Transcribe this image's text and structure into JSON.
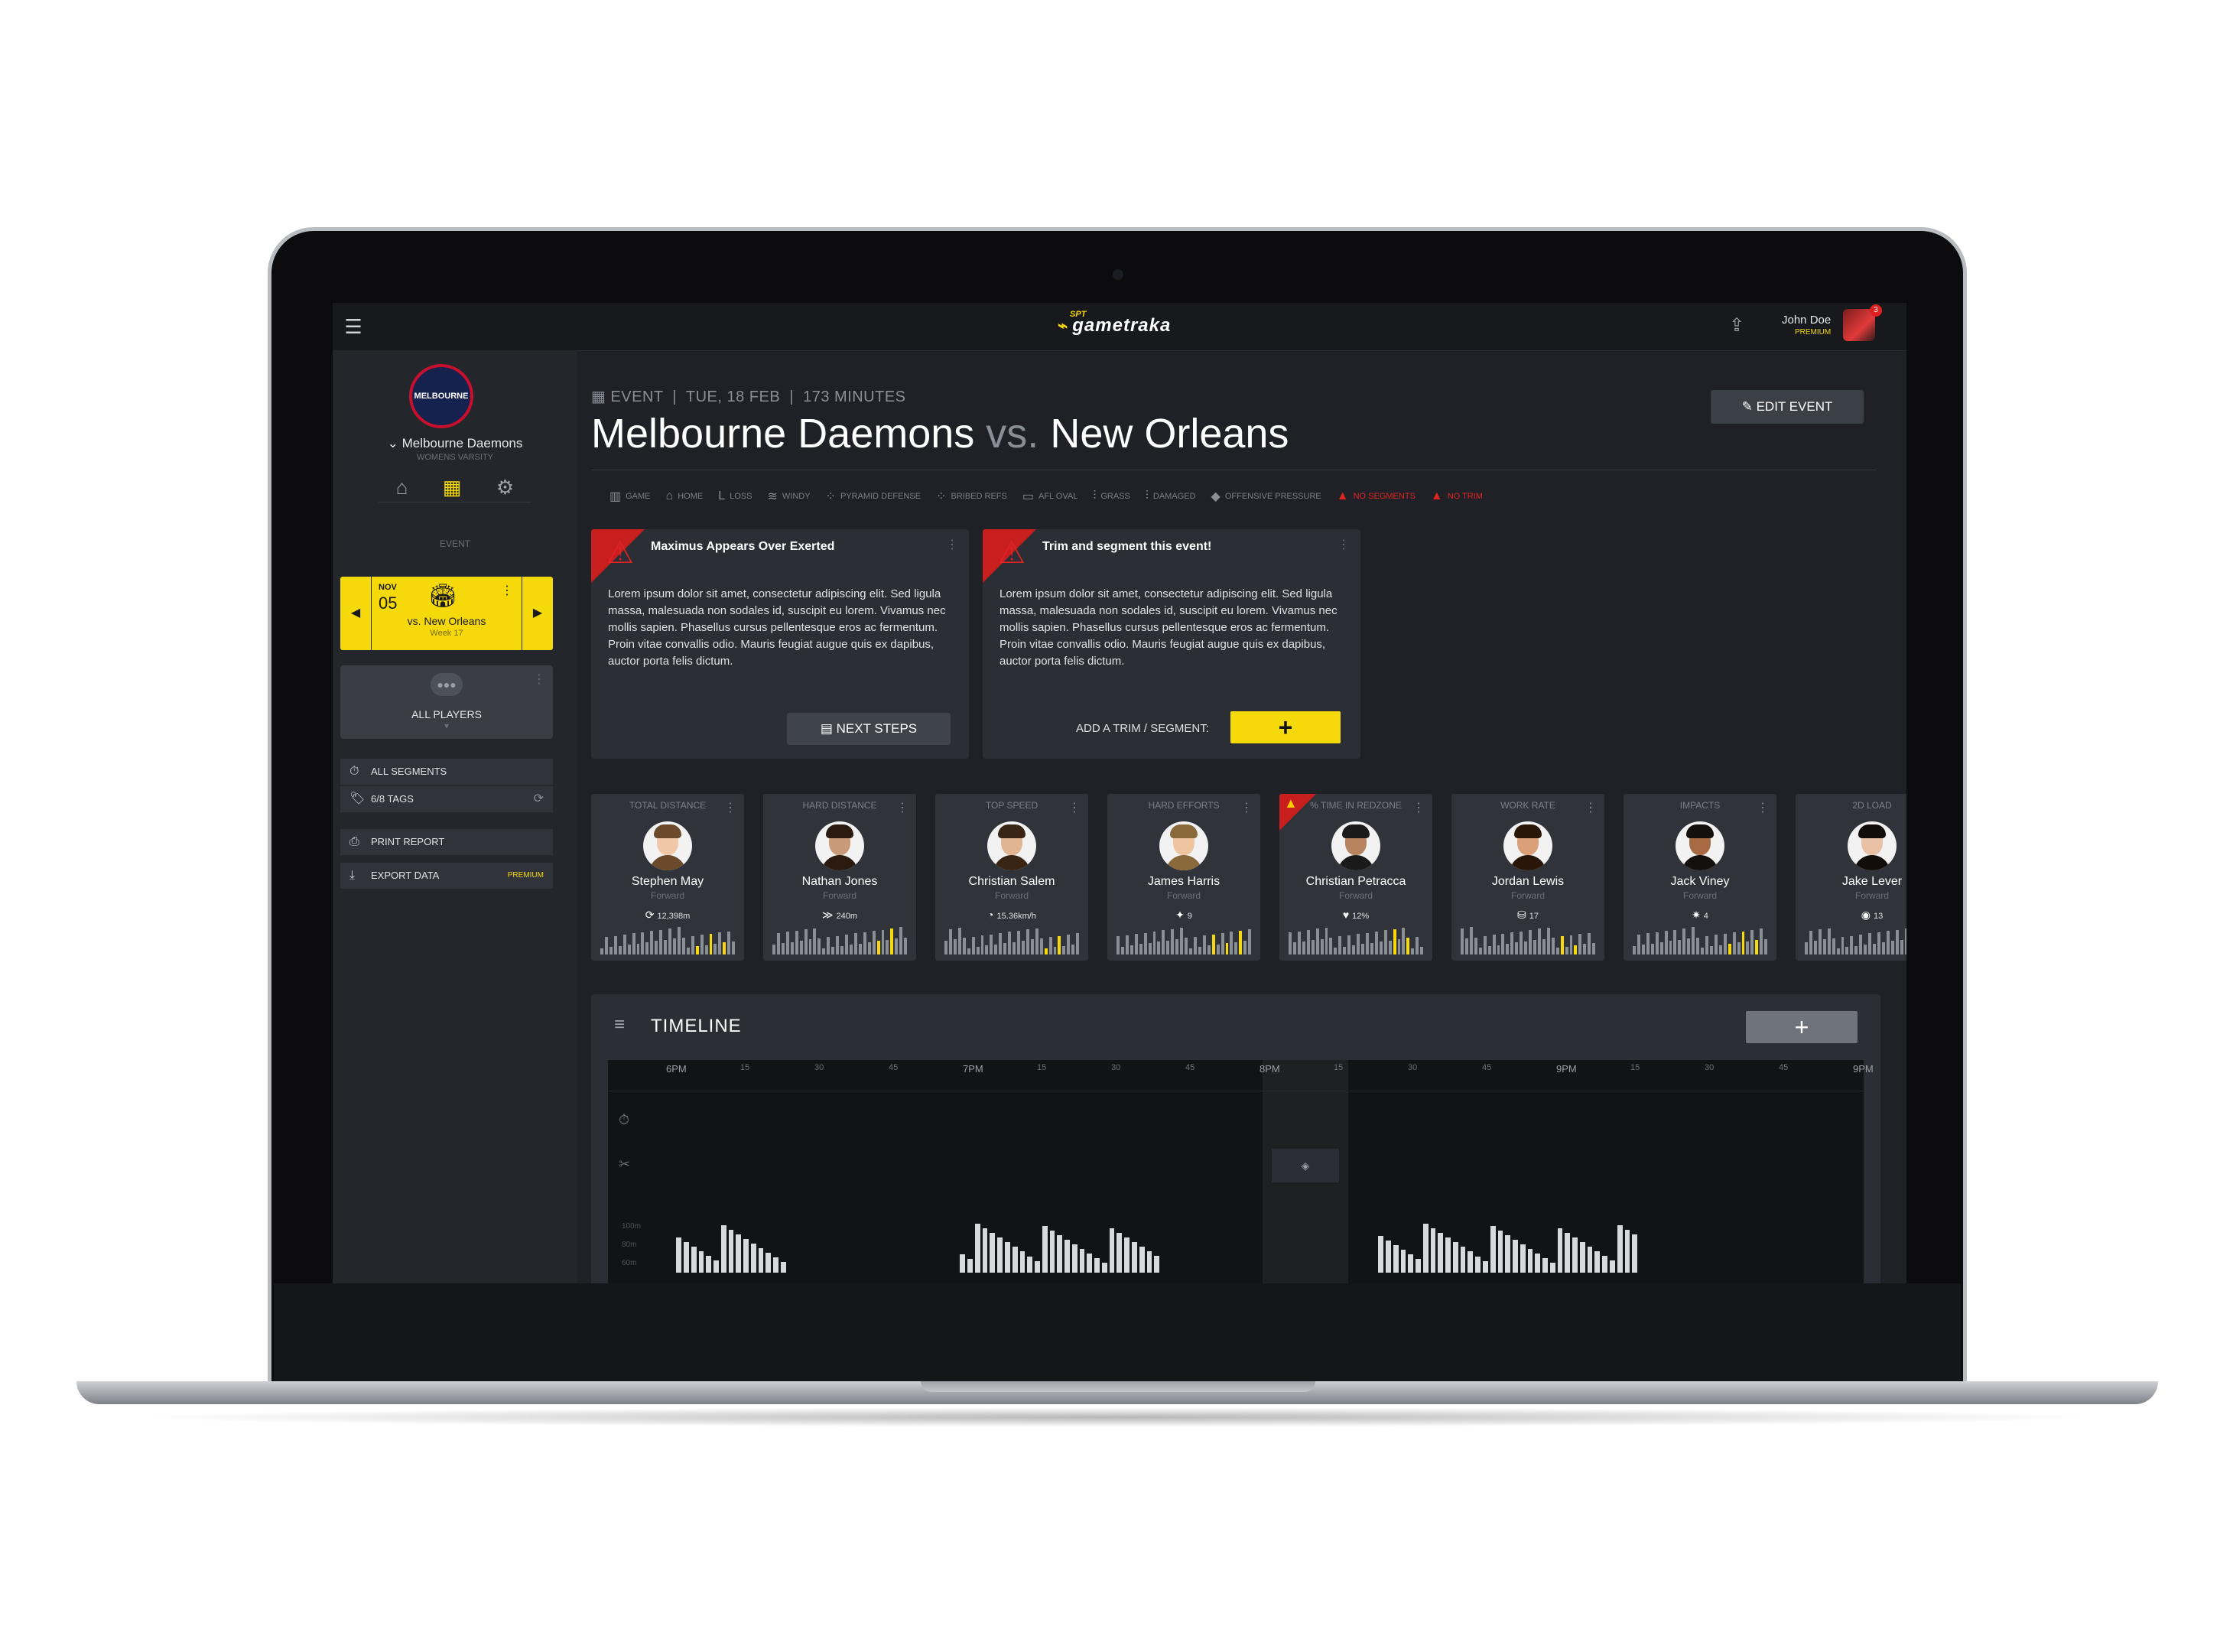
{
  "header": {
    "brand_small": "SPT",
    "brand_name": "gametraka",
    "user_name": "John Doe",
    "user_tier": "PREMIUM",
    "notifications": "3",
    "icons": [
      "menu-icon",
      "upload-icon"
    ]
  },
  "sidebar": {
    "club_logo_text": "MELBOURNE",
    "club_name": "Melbourne Daemons",
    "club_sub": "WOMENS VARSITY",
    "section_label": "EVENT",
    "event": {
      "month": "NOV",
      "day": "05",
      "opponent": "vs. New Orleans",
      "week": "Week 17"
    },
    "players_label": "ALL PLAYERS",
    "rows": [
      {
        "label": "ALL SEGMENTS"
      },
      {
        "label": "6/8 TAGS"
      },
      {
        "label": "PRINT REPORT"
      },
      {
        "label": "EXPORT DATA",
        "badge": "PREMIUM"
      }
    ]
  },
  "event_header": {
    "type": "EVENT",
    "date": "TUE, 18 FEB",
    "duration": "173 MINUTES",
    "home": "Melbourne Daemons",
    "vs": "vs.",
    "away": "New Orleans",
    "edit_label": "EDIT EVENT"
  },
  "tags": [
    {
      "label": "GAME",
      "icon": "stadium-icon"
    },
    {
      "label": "HOME",
      "icon": "home-icon"
    },
    {
      "label": "LOSS",
      "icon": "loss-icon"
    },
    {
      "label": "WINDY",
      "icon": "wind-icon"
    },
    {
      "label": "PYRAMID DEFENSE",
      "icon": "formation-icon"
    },
    {
      "label": "BRIBED REFS",
      "icon": "formation-icon"
    },
    {
      "label": "AFL OVAL",
      "icon": "field-icon"
    },
    {
      "label": "GRASS",
      "icon": "grass-icon"
    },
    {
      "label": "DAMAGED",
      "icon": "grass-icon"
    },
    {
      "label": "OFFENSIVE PRESSURE",
      "icon": "tag-icon"
    },
    {
      "label": "NO SEGMENTS",
      "icon": "warning-icon",
      "alert": true
    },
    {
      "label": "NO TRIM",
      "icon": "warning-icon",
      "alert": true
    }
  ],
  "alerts": [
    {
      "title": "Maximus Appears Over Exerted",
      "body": "Lorem ipsum dolor sit amet, consectetur adipiscing elit. Sed ligula massa, malesuada non sodales id, suscipit eu lorem. Vivamus nec mollis sapien. Phasellus cursus pellentesque eros ac fermentum. Proin vitae convallis odio. Mauris feugiat augue quis ex dapibus, auctor porta felis dictum.",
      "action_label": "NEXT STEPS"
    },
    {
      "title": "Trim and segment this event!",
      "body": "Lorem ipsum dolor sit amet, consectetur adipiscing elit. Sed ligula massa, malesuada non sodales id, suscipit eu lorem. Vivamus nec mollis sapien. Phasellus cursus pellentesque eros ac fermentum. Proin vitae convallis odio. Mauris feugiat augue quis ex dapibus, auctor porta felis dictum.",
      "action_label": "ADD A TRIM / SEGMENT:",
      "action_symbol": "+"
    }
  ],
  "leaders": [
    {
      "metric": "TOTAL DISTANCE",
      "name": "Stephen May",
      "position": "Forward",
      "value": "12,398m",
      "icon": "distance-icon",
      "skin": "#f0c8a8",
      "hair": "#6a4a2a"
    },
    {
      "metric": "HARD DISTANCE",
      "name": "Nathan Jones",
      "position": "Forward",
      "value": "240m",
      "icon": "sprint-icon",
      "skin": "#c99a78",
      "hair": "#2a1a10"
    },
    {
      "metric": "TOP SPEED",
      "name": "Christian Salem",
      "position": "Forward",
      "value": "15.36km/h",
      "icon": "speedometer-icon",
      "skin": "#e2b592",
      "hair": "#3a2414"
    },
    {
      "metric": "HARD EFFORTS",
      "name": "James Harris",
      "position": "Forward",
      "value": "9",
      "icon": "runner-icon",
      "skin": "#efc4a0",
      "hair": "#8a6a3a"
    },
    {
      "metric": "% TIME IN REDZONE",
      "name": "Christian Petracca",
      "position": "Forward",
      "value": "12%",
      "icon": "heart-icon",
      "skin": "#b88460",
      "hair": "#1a1a1a",
      "warning": true
    },
    {
      "metric": "WORK RATE",
      "name": "Jordan Lewis",
      "position": "Forward",
      "value": "17",
      "icon": "work-icon",
      "skin": "#d9a07a",
      "hair": "#2a1608"
    },
    {
      "metric": "IMPACTS",
      "name": "Jack Viney",
      "position": "Forward",
      "value": "4",
      "icon": "impact-icon",
      "skin": "#a86a42",
      "hair": "#151010"
    },
    {
      "metric": "2D LOAD",
      "name": "Jake Lever",
      "position": "Forward",
      "value": "13",
      "icon": "load-icon",
      "skin": "#e9c2a6",
      "hair": "#120c0a"
    }
  ],
  "timeline": {
    "title": "TIMELINE",
    "add_symbol": "+",
    "axis_labels": [
      "100m",
      "80m",
      "60m"
    ],
    "ticks": [
      "6PM",
      "15",
      "30",
      "45",
      "7PM",
      "15",
      "30",
      "45",
      "8PM",
      "15",
      "30",
      "45",
      "9PM",
      "15",
      "30",
      "45",
      "9PM"
    ]
  },
  "colors": {
    "accent": "#f5d90a",
    "alert": "#e02424",
    "panel": "#2b2e34",
    "background": "#1f2126"
  }
}
